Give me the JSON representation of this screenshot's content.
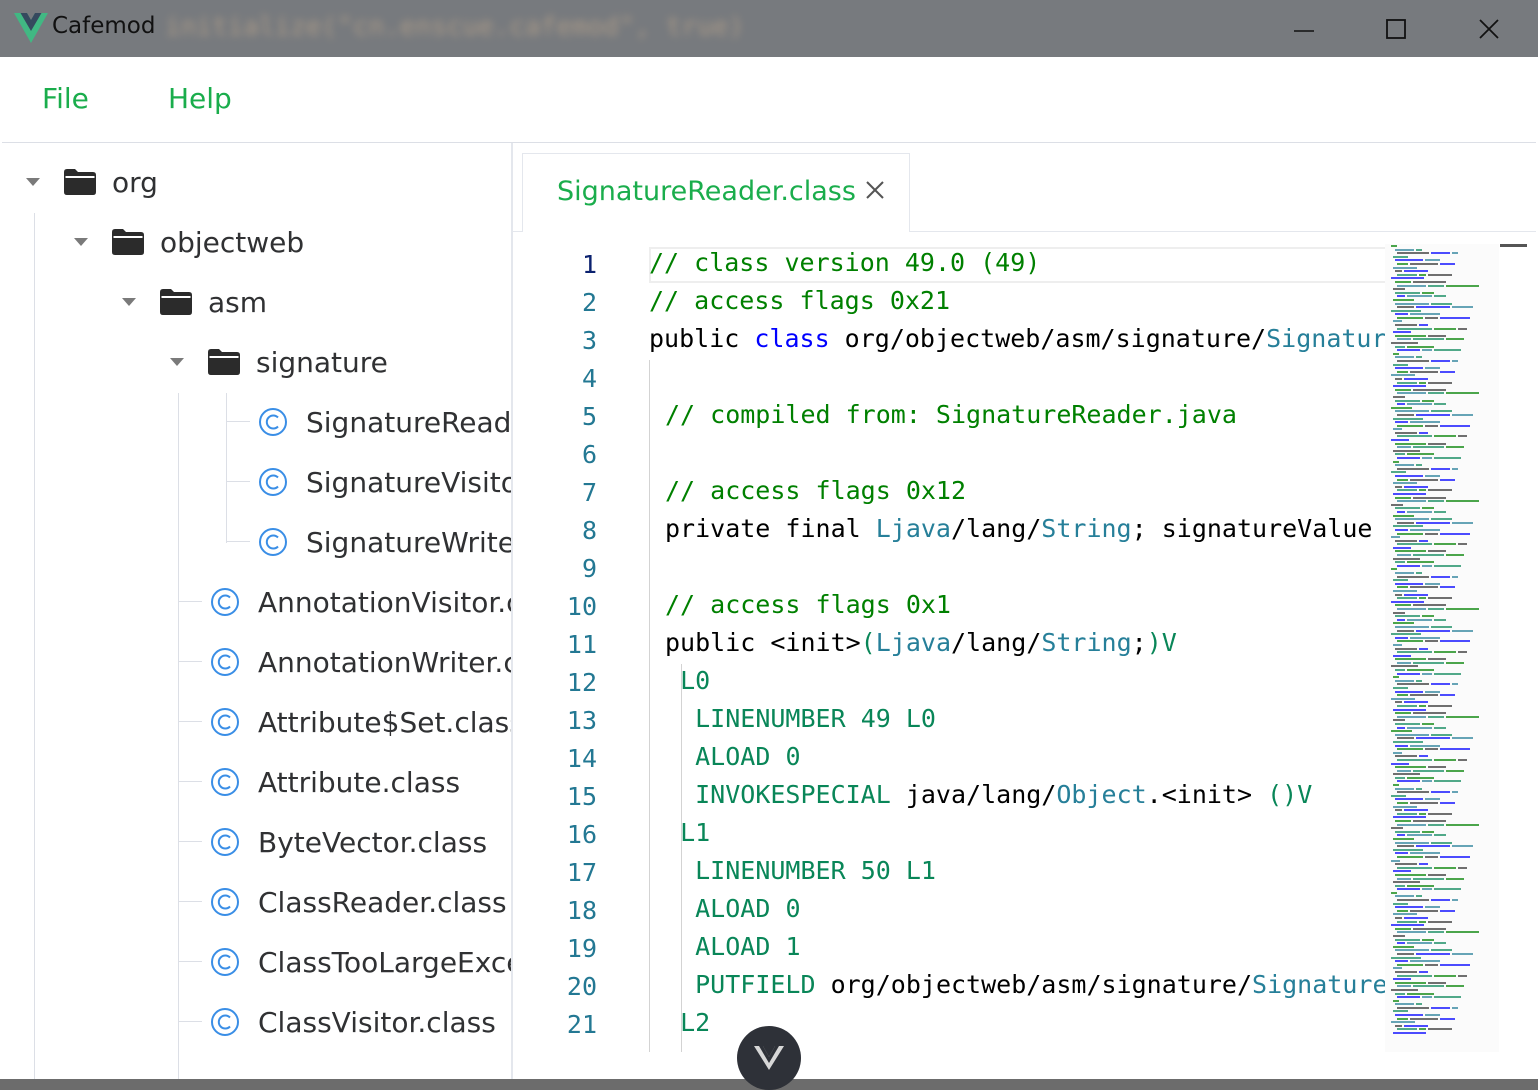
{
  "window": {
    "title": "Cafemod",
    "blurred_background_text": "initialize(\"cn.enscue.cafemod\", true)"
  },
  "menu": {
    "file_label": "File",
    "help_label": "Help"
  },
  "tree": {
    "org": "org",
    "objectweb": "objectweb",
    "asm": "asm",
    "signature": "signature",
    "signature_children": [
      "SignatureReader.class",
      "SignatureVisitor.class",
      "SignatureWriter.class"
    ],
    "asm_children": [
      "AnnotationVisitor.class",
      "AnnotationWriter.class",
      "Attribute$Set.class",
      "Attribute.class",
      "ByteVector.class",
      "ClassReader.class",
      "ClassTooLargeException.class",
      "ClassVisitor.class"
    ]
  },
  "tab": {
    "label": "SignatureReader.class"
  },
  "editor": {
    "active_line": 1,
    "line_numbers": [
      "1",
      "2",
      "3",
      "4",
      "5",
      "6",
      "7",
      "8",
      "9",
      "10",
      "11",
      "12",
      "13",
      "14",
      "15",
      "16",
      "17",
      "18",
      "19",
      "20",
      "21"
    ],
    "lines": [
      "// class version 49.0 (49)",
      "// access flags 0x21",
      "public class org/objectweb/asm/signature/SignatureReader {",
      "",
      "  // compiled from: SignatureReader.java",
      "",
      "  // access flags 0x12",
      "  private final Ljava/lang/String; signatureValue",
      "",
      "  // access flags 0x1",
      "  public <init>(Ljava/lang/String;)V",
      "   L0",
      "    LINENUMBER 49 L0",
      "    ALOAD 0",
      "    INVOKESPECIAL java/lang/Object.<init> ()V",
      "   L1",
      "    LINENUMBER 50 L1",
      "    ALOAD 0",
      "    ALOAD 1",
      "    PUTFIELD org/objectweb/asm/signature/SignatureReader.signatureValue : Ljava/lang/String;",
      "   L2"
    ]
  },
  "colors": {
    "accent_green": "#1aad4c",
    "comment_green": "#008000",
    "keyword_blue": "#0000ff",
    "type_teal": "#267f99",
    "instruction_green": "#098658",
    "line_number": "#237893",
    "titlebar": "#777a7e",
    "class_icon_blue": "#3a8ee6"
  },
  "icons": {
    "app_logo": "vue-logo-icon",
    "minimize": "minimize-icon",
    "maximize": "maximize-icon",
    "close": "close-icon",
    "folder": "folder-icon",
    "class_file": "class-file-icon",
    "tab_close": "tab-close-icon",
    "devtools": "vue-devtools-icon"
  }
}
